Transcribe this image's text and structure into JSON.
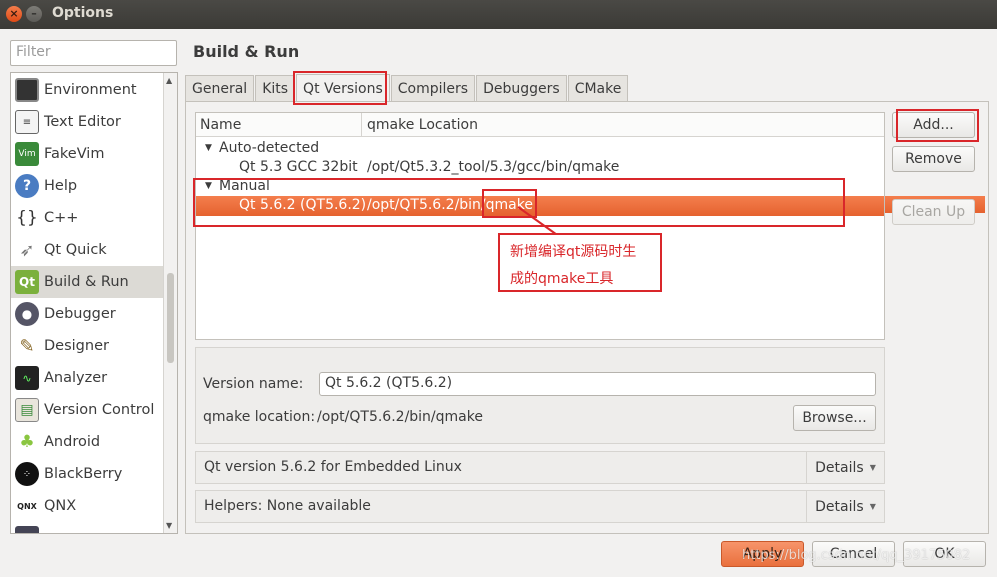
{
  "window": {
    "title": "Options"
  },
  "sidebar": {
    "filter_placeholder": "Filter",
    "items": [
      {
        "label": "Environment",
        "icon": "monitor-icon"
      },
      {
        "label": "Text Editor",
        "icon": "text-editor-icon"
      },
      {
        "label": "FakeVim",
        "icon": "fakevim-icon"
      },
      {
        "label": "Help",
        "icon": "help-icon"
      },
      {
        "label": "C++",
        "icon": "cpp-braces-icon"
      },
      {
        "label": "Qt Quick",
        "icon": "qt-quick-icon"
      },
      {
        "label": "Build & Run",
        "icon": "qt-build-icon",
        "selected": true
      },
      {
        "label": "Debugger",
        "icon": "debugger-icon"
      },
      {
        "label": "Designer",
        "icon": "designer-icon"
      },
      {
        "label": "Analyzer",
        "icon": "analyzer-icon"
      },
      {
        "label": "Version Control",
        "icon": "version-control-icon"
      },
      {
        "label": "Android",
        "icon": "android-icon"
      },
      {
        "label": "BlackBerry",
        "icon": "blackberry-icon"
      },
      {
        "label": "QNX",
        "icon": "qnx-icon"
      }
    ]
  },
  "main": {
    "title": "Build & Run",
    "tabs": [
      "General",
      "Kits",
      "Qt Versions",
      "Compilers",
      "Debuggers",
      "CMake"
    ],
    "active_tab": "Qt Versions",
    "tree": {
      "headers": [
        "Name",
        "qmake Location"
      ],
      "groups": [
        {
          "label": "Auto-detected",
          "rows": [
            {
              "name": "Qt 5.3 GCC 32bit",
              "location": "/opt/Qt5.3.2_tool/5.3/gcc/bin/qmake"
            }
          ]
        },
        {
          "label": "Manual",
          "rows": [
            {
              "name": "Qt 5.6.2 (QT5.6.2)",
              "location_prefix": "/opt/QT5.6.2/bin/",
              "location_suffix": "qmake",
              "selected": true
            }
          ]
        }
      ]
    },
    "buttons": {
      "add": "Add...",
      "remove": "Remove",
      "cleanup": "Clean Up"
    },
    "detail": {
      "version_name_label": "Version name:",
      "version_name_value": "Qt 5.6.2 (QT5.6.2)",
      "qmake_location_label": "qmake location:",
      "qmake_location_value": "/opt/QT5.6.2/bin/qmake",
      "browse": "Browse..."
    },
    "info_rows": [
      {
        "label": "Qt version 5.6.2 for Embedded Linux",
        "button": "Details"
      },
      {
        "label": "Helpers: None available",
        "button": "Details"
      }
    ],
    "annotation": {
      "line1": "新增编译qt源码时生",
      "line2": "成的qmake工具"
    }
  },
  "footer": {
    "apply": "Apply",
    "cancel": "Cancel",
    "ok": "OK",
    "watermark": "https://blog.csdn.net/qq_39175082"
  },
  "colors": {
    "selection": "#e9683a",
    "annotation": "#d9262a"
  }
}
